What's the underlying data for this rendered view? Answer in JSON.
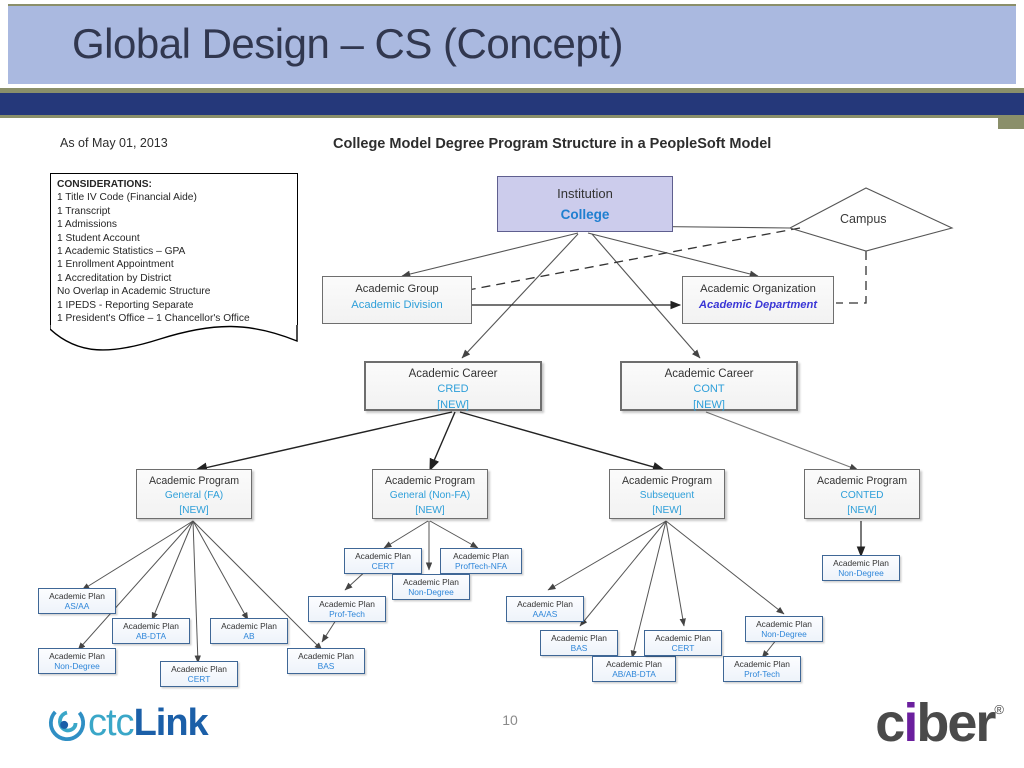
{
  "slide": {
    "title": "Global Design – CS (Concept)",
    "page_number": "10",
    "band_color": "#aab9e0",
    "accent_dark": "#25387a",
    "accent_olive": "#8a8f6a"
  },
  "diagram": {
    "as_of": "As of May 01, 2013",
    "title": "College Model Degree Program Structure in a PeopleSoft Model"
  },
  "considerations": {
    "header": "CONSIDERATIONS:",
    "items": [
      "1 Title IV Code (Financial Aide)",
      "1 Transcript",
      "1 Admissions",
      "1 Student Account",
      "1 Academic Statistics – GPA",
      "1 Enrollment Appointment",
      "1 Accreditation by District",
      "No Overlap in Academic Structure",
      "1 IPEDS  - Reporting Separate",
      "1 President's Office – 1 Chancellor's Office"
    ]
  },
  "nodes": {
    "institution": {
      "type": "Institution",
      "value": "College"
    },
    "campus": {
      "label": "Campus"
    },
    "academic_group": {
      "type": "Academic Group",
      "value": "Academic Division"
    },
    "academic_organization": {
      "type": "Academic Organization",
      "value": "Academic Department"
    },
    "careers": [
      {
        "type": "Academic Career",
        "value": "CRED",
        "tag": "[NEW]"
      },
      {
        "type": "Academic Career",
        "value": "CONT",
        "tag": "[NEW]"
      }
    ],
    "programs": [
      {
        "type": "Academic Program",
        "value": "General (FA)",
        "tag": "[NEW]"
      },
      {
        "type": "Academic Program",
        "value": "General (Non-FA)",
        "tag": "[NEW]"
      },
      {
        "type": "Academic Program",
        "value": "Subsequent",
        "tag": "[NEW]"
      },
      {
        "type": "Academic Program",
        "value": "CONTED",
        "tag": "[NEW]"
      }
    ],
    "plans_general_fa": [
      {
        "type": "Academic Plan",
        "value": "AS/AA"
      },
      {
        "type": "Academic Plan",
        "value": "Non-Degree"
      },
      {
        "type": "Academic Plan",
        "value": "AB-DTA"
      },
      {
        "type": "Academic Plan",
        "value": "CERT"
      },
      {
        "type": "Academic Plan",
        "value": "AB"
      },
      {
        "type": "Academic Plan",
        "value": "BAS"
      }
    ],
    "plans_general_nonfa": [
      {
        "type": "Academic Plan",
        "value": "CERT"
      },
      {
        "type": "Academic Plan",
        "value": "ProfTech-NFA"
      },
      {
        "type": "Academic Plan",
        "value": "Non-Degree"
      },
      {
        "type": "Academic Plan",
        "value": "Prof-Tech"
      }
    ],
    "plans_subsequent": [
      {
        "type": "Academic Plan",
        "value": "AA/AS"
      },
      {
        "type": "Academic Plan",
        "value": "BAS"
      },
      {
        "type": "Academic Plan",
        "value": "AB/AB-DTA"
      },
      {
        "type": "Academic Plan",
        "value": "CERT"
      },
      {
        "type": "Academic Plan",
        "value": "Non-Degree"
      },
      {
        "type": "Academic Plan",
        "value": "Prof-Tech"
      }
    ],
    "plans_conted": [
      {
        "type": "Academic Plan",
        "value": "Non-Degree"
      }
    ]
  },
  "footer": {
    "ctclink_ctc": "ctc",
    "ctclink_link": "Link",
    "ciber_c": "c",
    "ciber_i": "i",
    "ciber_ber": "ber",
    "ciber_reg": "®"
  }
}
